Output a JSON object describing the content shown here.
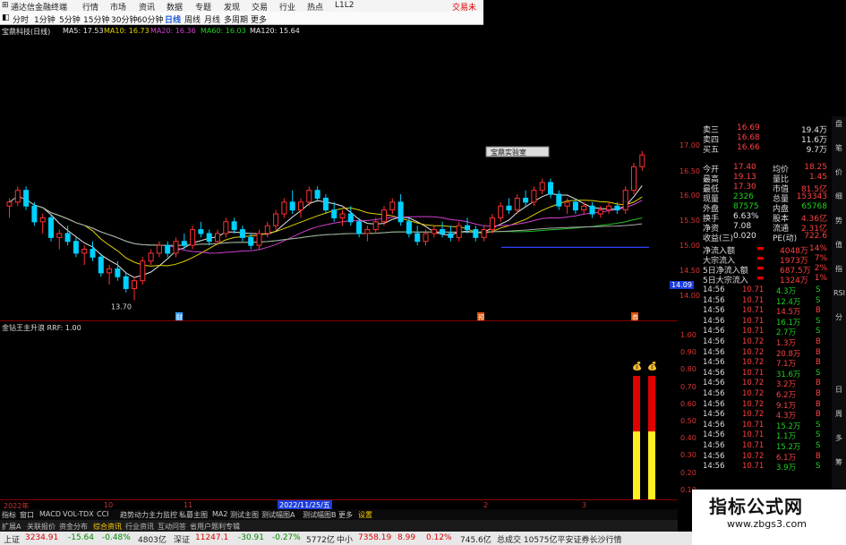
{
  "topbar": {
    "app_title": "通达信金融终端",
    "menu": [
      "行情",
      "市场",
      "资讯",
      "数据",
      "专题",
      "发现",
      "交易",
      "行业",
      "热点",
      "L1L2"
    ],
    "login": "交易未"
  },
  "timeframes": [
    "分时",
    "1分钟",
    "5分钟",
    "15分钟",
    "30分钟",
    "60分钟",
    "日线",
    "周线",
    "月线",
    "多周期",
    "更多"
  ],
  "ma_legend": {
    "stock": "宝鼎科技(日线)",
    "items": [
      {
        "label": "MA5: 17.53",
        "color": "#e6e6e6"
      },
      {
        "label": "MA10: 16.73",
        "color": "#e0d000"
      },
      {
        "label": "MA20: 16.36",
        "color": "#d040d0"
      },
      {
        "label": "MA60: 16.03",
        "color": "#20c020"
      },
      {
        "label": "MA120: 15.64",
        "color": "#c8c8c8"
      }
    ]
  },
  "main_chart": {
    "low_label": "13.70",
    "tooltip": "宝鼎实验室",
    "price_axis": [
      "17.00",
      "16.50",
      "16.00",
      "15.50",
      "15.00",
      "14.50",
      "14.00"
    ],
    "current_price_label": "14.09",
    "event_markers": [
      "财",
      "预",
      "券"
    ],
    "candles": [
      [
        16.1,
        16.3,
        15.8,
        16.2
      ],
      [
        16.2,
        16.6,
        16.1,
        16.5
      ],
      [
        16.5,
        16.6,
        16.0,
        16.1
      ],
      [
        16.1,
        16.2,
        15.6,
        15.7
      ],
      [
        15.7,
        15.9,
        15.4,
        15.8
      ],
      [
        15.8,
        15.9,
        15.2,
        15.3
      ],
      [
        15.3,
        15.5,
        15.0,
        15.4
      ],
      [
        15.4,
        15.6,
        15.1,
        15.2
      ],
      [
        15.2,
        15.3,
        14.8,
        14.9
      ],
      [
        14.9,
        15.1,
        14.6,
        15.0
      ],
      [
        15.0,
        15.2,
        14.7,
        14.8
      ],
      [
        14.8,
        14.9,
        14.3,
        14.4
      ],
      [
        14.4,
        14.6,
        14.1,
        14.5
      ],
      [
        14.5,
        14.7,
        14.2,
        14.3
      ],
      [
        14.3,
        14.4,
        13.9,
        14.0
      ],
      [
        14.0,
        14.3,
        13.7,
        14.2
      ],
      [
        14.2,
        14.8,
        14.1,
        14.7
      ],
      [
        14.7,
        15.0,
        14.6,
        14.9
      ],
      [
        14.9,
        15.2,
        14.8,
        15.1
      ],
      [
        15.1,
        15.2,
        14.8,
        14.9
      ],
      [
        14.9,
        15.3,
        14.8,
        15.2
      ],
      [
        15.2,
        15.4,
        15.0,
        15.1
      ],
      [
        15.1,
        15.6,
        15.0,
        15.5
      ],
      [
        15.5,
        15.7,
        15.3,
        15.4
      ],
      [
        15.4,
        15.5,
        15.1,
        15.2
      ],
      [
        15.2,
        15.5,
        15.1,
        15.4
      ],
      [
        15.4,
        15.8,
        15.3,
        15.7
      ],
      [
        15.7,
        15.8,
        15.4,
        15.5
      ],
      [
        15.5,
        15.6,
        15.2,
        15.3
      ],
      [
        15.3,
        15.4,
        15.0,
        15.1
      ],
      [
        15.1,
        15.5,
        15.0,
        15.4
      ],
      [
        15.4,
        15.7,
        15.3,
        15.6
      ],
      [
        15.6,
        16.0,
        15.5,
        15.9
      ],
      [
        15.9,
        16.3,
        15.8,
        16.2
      ],
      [
        16.2,
        16.5,
        15.9,
        16.0
      ],
      [
        16.0,
        16.3,
        15.8,
        16.2
      ],
      [
        16.2,
        16.6,
        16.1,
        16.5
      ],
      [
        16.5,
        16.6,
        16.2,
        16.3
      ],
      [
        16.3,
        16.4,
        15.9,
        16.0
      ],
      [
        16.0,
        16.2,
        15.7,
        15.8
      ],
      [
        15.8,
        16.0,
        15.6,
        15.9
      ],
      [
        15.9,
        16.1,
        15.6,
        15.7
      ],
      [
        15.7,
        15.8,
        15.3,
        15.4
      ],
      [
        15.4,
        15.6,
        15.2,
        15.5
      ],
      [
        15.5,
        15.8,
        15.4,
        15.7
      ],
      [
        15.7,
        16.1,
        15.6,
        16.0
      ],
      [
        16.0,
        16.3,
        15.9,
        16.2
      ],
      [
        16.2,
        16.4,
        15.6,
        15.7
      ],
      [
        15.7,
        15.8,
        15.3,
        15.4
      ],
      [
        15.4,
        15.6,
        15.1,
        15.2
      ],
      [
        15.2,
        15.5,
        15.1,
        15.4
      ],
      [
        15.4,
        15.6,
        15.3,
        15.5
      ],
      [
        15.5,
        15.7,
        15.3,
        15.4
      ],
      [
        15.4,
        15.6,
        15.2,
        15.3
      ],
      [
        15.3,
        15.7,
        15.2,
        15.6
      ],
      [
        15.6,
        15.8,
        15.4,
        15.5
      ],
      [
        15.5,
        15.6,
        15.2,
        15.3
      ],
      [
        15.3,
        15.6,
        15.2,
        15.5
      ],
      [
        15.5,
        15.9,
        15.4,
        15.8
      ],
      [
        15.8,
        16.2,
        15.7,
        16.1
      ],
      [
        16.1,
        16.3,
        15.9,
        16.0
      ],
      [
        16.0,
        16.4,
        15.9,
        16.3
      ],
      [
        16.3,
        16.5,
        16.1,
        16.2
      ],
      [
        16.2,
        16.6,
        16.1,
        16.5
      ],
      [
        16.5,
        16.8,
        16.4,
        16.7
      ],
      [
        16.7,
        16.8,
        16.3,
        16.4
      ],
      [
        16.4,
        16.5,
        16.0,
        16.1
      ],
      [
        16.1,
        16.3,
        15.9,
        16.2
      ],
      [
        16.2,
        16.3,
        15.9,
        16.0
      ],
      [
        16.0,
        16.2,
        15.9,
        16.1
      ],
      [
        16.1,
        16.2,
        15.8,
        15.9
      ],
      [
        15.9,
        16.1,
        15.8,
        16.0
      ],
      [
        16.0,
        16.2,
        15.9,
        16.1
      ],
      [
        16.1,
        16.2,
        15.9,
        16.0
      ],
      [
        16.0,
        16.6,
        15.9,
        16.5
      ],
      [
        16.5,
        17.2,
        16.4,
        17.1
      ],
      [
        17.1,
        17.5,
        17.0,
        17.4
      ]
    ]
  },
  "sub_chart": {
    "label": "金钻王主升浪 RRF: 1.00",
    "axis": [
      "1.00",
      "0.90",
      "0.80",
      "0.70",
      "0.60",
      "0.50",
      "0.40",
      "0.30",
      "0.20",
      "0.10"
    ],
    "bars": [
      {
        "red_frac": 0.45,
        "yellow_frac": 0.55
      },
      {
        "red_frac": 0.45,
        "yellow_frac": 0.55
      }
    ]
  },
  "quote_panel": {
    "levels": [
      {
        "name": "卖三",
        "price": "16.69",
        "vol": "19.4万"
      },
      {
        "name": "卖四",
        "price": "16.68",
        "vol": "11.6万"
      },
      {
        "name": "买五",
        "price": "16.66",
        "vol": "9.7万"
      }
    ],
    "stats": [
      {
        "k1": "今开",
        "v1": "17.40",
        "k2": "均价",
        "v2": "18.25"
      },
      {
        "k1": "最高",
        "v1": "19.13",
        "k2": "量比",
        "v2": "1.45"
      },
      {
        "k1": "最低",
        "v1": "17.30",
        "k2": "市值",
        "v2": "81.5亿"
      },
      {
        "k1": "现量",
        "v1": "2326",
        "k2": "总量",
        "v2": "153343"
      },
      {
        "k1": "外盘",
        "v1": "87575",
        "k2": "内盘",
        "v2": "65768"
      },
      {
        "k1": "换手",
        "v1": "6.63%",
        "k2": "股本",
        "v2": "4.36亿"
      },
      {
        "k1": "净资",
        "v1": "7.08",
        "k2": "流通",
        "v2": "2.31亿"
      },
      {
        "k1": "收益(三)",
        "v1": "0.020",
        "k2": "PE(动)",
        "v2": "722.6"
      }
    ],
    "flows": [
      {
        "name": "净流入额",
        "value": "4048万",
        "pct": "14%"
      },
      {
        "name": "大宗流入",
        "value": "1973万",
        "pct": "7%"
      },
      {
        "name": "5日净流入额",
        "value": "687.5万",
        "pct": "2%"
      },
      {
        "name": "5日大宗流入",
        "value": "1324万",
        "pct": "1%"
      }
    ],
    "ticks": [
      {
        "t": "14:56",
        "p": "10.71",
        "v": "4.3万",
        "d": "S"
      },
      {
        "t": "14:56",
        "p": "10.71",
        "v": "12.4万",
        "d": "S"
      },
      {
        "t": "14:56",
        "p": "10.71",
        "v": "14.5万",
        "d": "B"
      },
      {
        "t": "14:56",
        "p": "10.71",
        "v": "16.1万",
        "d": "S"
      },
      {
        "t": "14:56",
        "p": "10.71",
        "v": "2.7万",
        "d": "S"
      },
      {
        "t": "14:56",
        "p": "10.72",
        "v": "1.3万",
        "d": "B"
      },
      {
        "t": "14:56",
        "p": "10.72",
        "v": "20.8万",
        "d": "B"
      },
      {
        "t": "14:56",
        "p": "10.72",
        "v": "7.1万",
        "d": "B"
      },
      {
        "t": "14:56",
        "p": "10.71",
        "v": "31.6万",
        "d": "S"
      },
      {
        "t": "14:56",
        "p": "10.72",
        "v": "3.2万",
        "d": "B"
      },
      {
        "t": "14:56",
        "p": "10.72",
        "v": "6.2万",
        "d": "B"
      },
      {
        "t": "14:56",
        "p": "10.72",
        "v": "9.1万",
        "d": "B"
      },
      {
        "t": "14:56",
        "p": "10.72",
        "v": "4.3万",
        "d": "B"
      },
      {
        "t": "14:56",
        "p": "10.71",
        "v": "15.2万",
        "d": "S"
      },
      {
        "t": "14:56",
        "p": "10.71",
        "v": "1.1万",
        "d": "S"
      },
      {
        "t": "14:56",
        "p": "10.71",
        "v": "15.2万",
        "d": "S"
      },
      {
        "t": "14:56",
        "p": "10.72",
        "v": "6.1万",
        "d": "B"
      },
      {
        "t": "14:56",
        "p": "10.71",
        "v": "3.9万",
        "d": "S"
      }
    ]
  },
  "side_tabs": [
    "盘",
    "笔",
    "价",
    "细",
    "势",
    "值",
    "指",
    "RSI",
    "分",
    "",
    "",
    "日",
    "周",
    "多",
    "筹"
  ],
  "dates": [
    "2022年",
    "10",
    "11",
    "2022/11/25/五",
    "2",
    "3"
  ],
  "indicators": [
    "指标",
    "窗口",
    "MACD",
    "VOL-TDX",
    "CCI",
    "趋势动力",
    "主力监控",
    "私募主图",
    "MA2",
    "测试主图",
    "测试幅图A",
    "测试幅图B",
    "更多",
    "设置"
  ],
  "pages": [
    "扩展A",
    "关联报价",
    "资金分布",
    "综合资讯",
    "行业资讯",
    "互动问答",
    "省用户题利专辑"
  ],
  "index_bar": [
    {
      "name": "上证",
      "value": "3234.91",
      "chg": "-15.64",
      "pct": "-0.48%",
      "amt": "4803亿"
    },
    {
      "name": "深证",
      "value": "11247.1",
      "chg": "-30.91",
      "pct": "-0.27%",
      "amt": "5772亿"
    },
    {
      "name": "中小",
      "value": "7358.19",
      "chg": "8.99",
      "pct": "0.12%",
      "amt": "745.6亿"
    }
  ],
  "ticker_text": "总成交 10575亿平安证券长沙行情",
  "watermark": {
    "title": "指标公式网",
    "url": "www.zbgs3.com"
  },
  "colors": {
    "up": "#ff3030",
    "down": "#00d0ff",
    "bg": "#000000",
    "grid": "#800000"
  }
}
